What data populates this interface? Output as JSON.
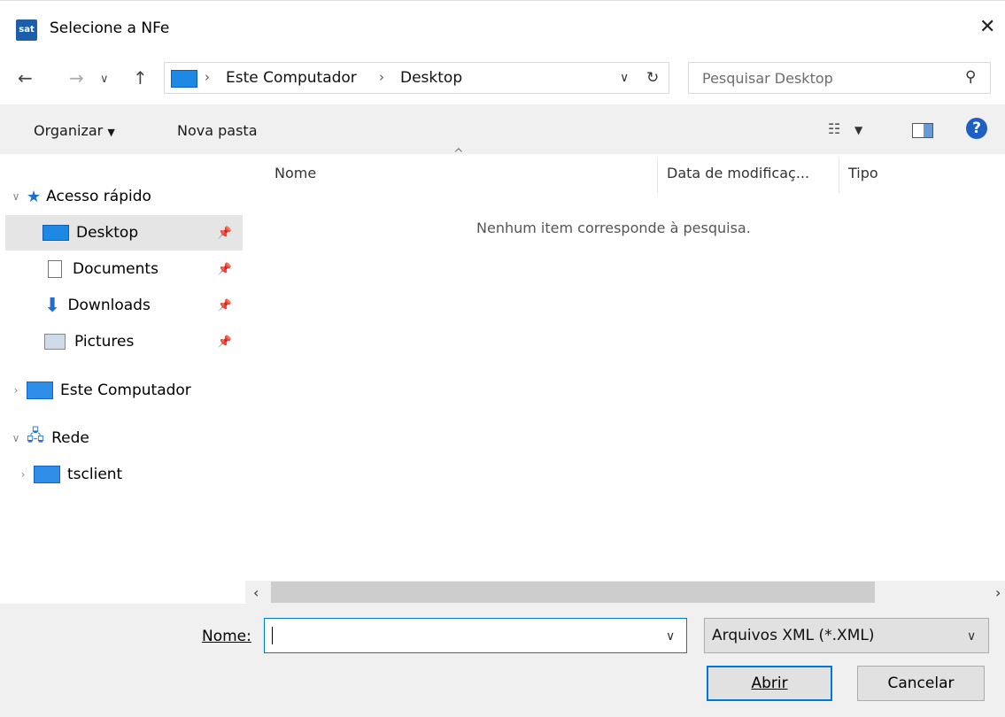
{
  "window": {
    "title": "Selecione a NFe",
    "app_icon": "sat"
  },
  "nav": {
    "breadcrumbs": [
      "Este Computador",
      "Desktop"
    ],
    "search_placeholder": "Pesquisar Desktop"
  },
  "toolbar": {
    "organize": "Organizar",
    "new_folder": "Nova pasta"
  },
  "sidebar": {
    "quick_access": "Acesso rápido",
    "items": [
      {
        "label": "Desktop"
      },
      {
        "label": "Documents"
      },
      {
        "label": "Downloads"
      },
      {
        "label": "Pictures"
      }
    ],
    "this_pc": "Este Computador",
    "network": "Rede",
    "tsclient": "tsclient"
  },
  "file_list": {
    "columns": [
      "Nome",
      "Data de modificaç...",
      "Tipo"
    ],
    "empty_message": "Nenhum item corresponde à pesquisa."
  },
  "bottom": {
    "name_label": "Nome:",
    "name_value": "",
    "file_type": "Arquivos XML (*.XML)",
    "open_button": "Abrir",
    "cancel_button": "Cancelar"
  },
  "colors": {
    "accent": "#0078d7",
    "help": "#1f5fc3"
  }
}
